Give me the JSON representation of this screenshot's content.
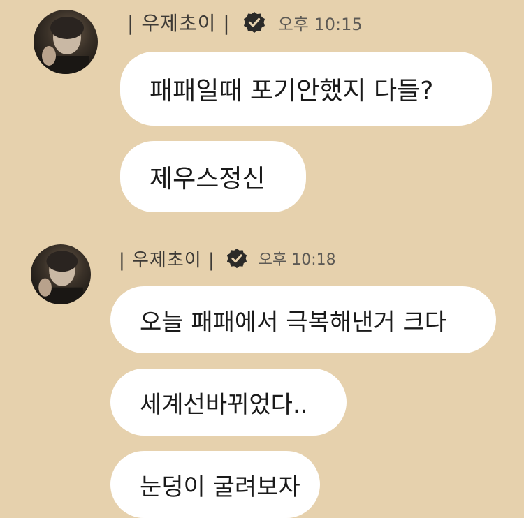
{
  "messages": [
    {
      "sender": "| 우제초이 |",
      "time": "오후 10:15",
      "bubbles": [
        "패패일때 포기안했지 다들?",
        "제우스정신"
      ]
    },
    {
      "sender": "| 우제초이 |",
      "time": "오후 10:18",
      "bubbles": [
        "오늘 패패에서 극복해낸거 크다",
        "세계선바뀌었다..",
        "눈덩이 굴려보자"
      ]
    }
  ],
  "colors": {
    "background": "#e6d1ad",
    "bubble": "#ffffff",
    "verified_badge": "#2b2a28"
  },
  "icons": {
    "verified": "verified-badge-icon"
  }
}
